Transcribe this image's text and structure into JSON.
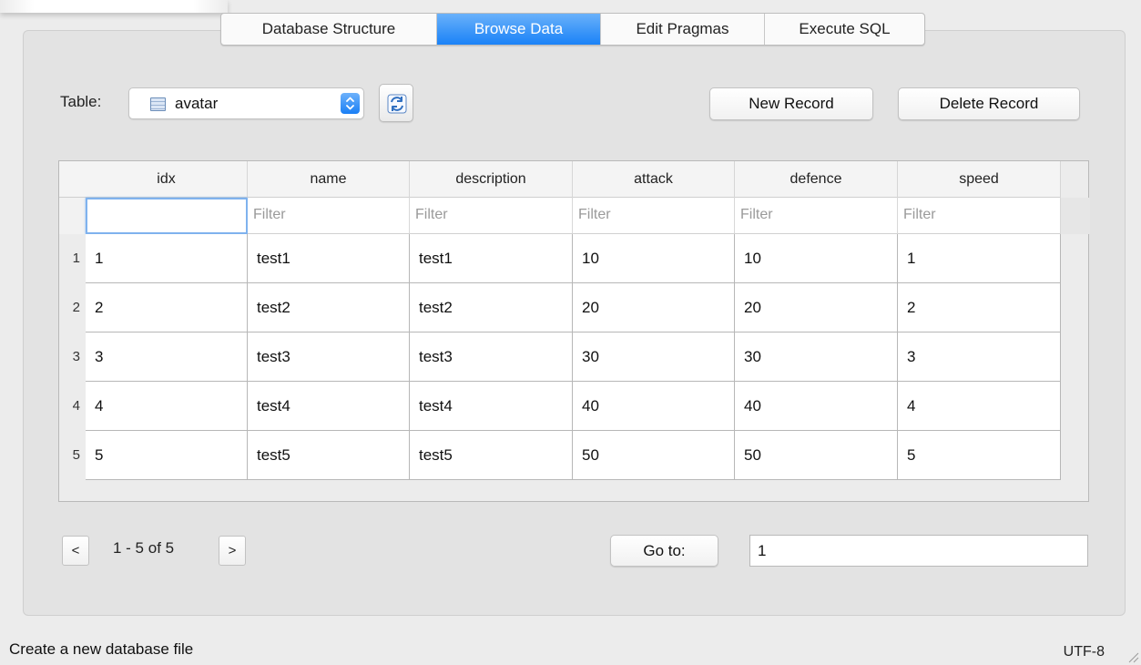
{
  "tabs": [
    {
      "label": "Database Structure",
      "active": false
    },
    {
      "label": "Browse Data",
      "active": true
    },
    {
      "label": "Edit Pragmas",
      "active": false
    },
    {
      "label": "Execute SQL",
      "active": false
    }
  ],
  "table_selector": {
    "label": "Table:",
    "value": "avatar",
    "icon": "table-icon"
  },
  "toolbar": {
    "refresh_icon": "refresh-icon",
    "new_record_label": "New Record",
    "delete_record_label": "Delete Record"
  },
  "grid": {
    "columns": [
      "idx",
      "name",
      "description",
      "attack",
      "defence",
      "speed"
    ],
    "filter_placeholders": [
      "",
      "Filter",
      "Filter",
      "Filter",
      "Filter",
      "Filter"
    ],
    "rows": [
      {
        "num": "1",
        "cells": [
          "1",
          "test1",
          "test1",
          "10",
          "10",
          "1"
        ]
      },
      {
        "num": "2",
        "cells": [
          "2",
          "test2",
          "test2",
          "20",
          "20",
          "2"
        ]
      },
      {
        "num": "3",
        "cells": [
          "3",
          "test3",
          "test3",
          "30",
          "30",
          "3"
        ]
      },
      {
        "num": "4",
        "cells": [
          "4",
          "test4",
          "test4",
          "40",
          "40",
          "4"
        ]
      },
      {
        "num": "5",
        "cells": [
          "5",
          "test5",
          "test5",
          "50",
          "50",
          "5"
        ]
      }
    ]
  },
  "pagination": {
    "prev_label": "<",
    "next_label": ">",
    "status": "1 - 5 of 5",
    "goto_label": "Go to:",
    "goto_value": "1"
  },
  "status_bar": {
    "message": "Create a new database file",
    "encoding": "UTF-8"
  },
  "colors": {
    "accent": "#1a82f7",
    "focus_ring": "#7fb2ee"
  }
}
